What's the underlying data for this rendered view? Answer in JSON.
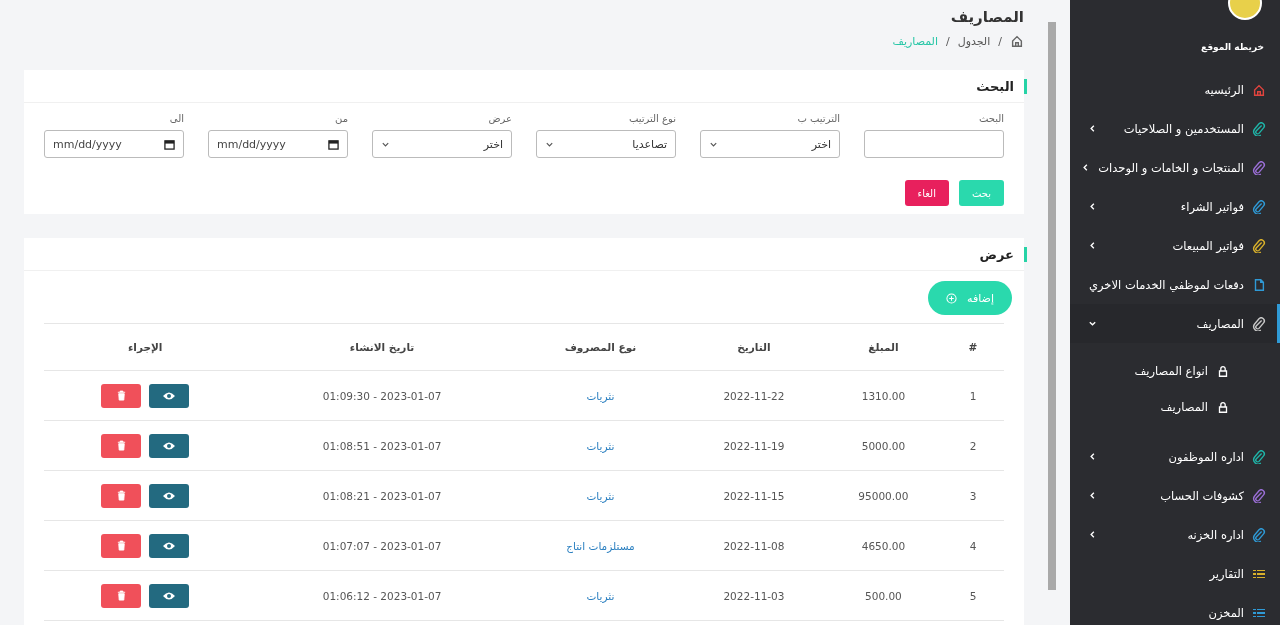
{
  "page": {
    "title": "المصاريف",
    "separator": "/",
    "breadcrumb": [
      {
        "label": "الجدول",
        "current": false
      },
      {
        "label": "المصاريف",
        "current": true
      }
    ]
  },
  "search": {
    "title": "البحث",
    "fields": [
      {
        "kind": "text",
        "label": "البحث"
      },
      {
        "kind": "select",
        "label": "الترتيب ب",
        "value": "اختر"
      },
      {
        "kind": "select",
        "label": "نوع الترتيب",
        "value": "تصاعديا"
      },
      {
        "kind": "select",
        "label": "عرض",
        "value": "اختر"
      },
      {
        "kind": "date",
        "label": "من",
        "placeholder": "mm/dd/yyyy"
      },
      {
        "kind": "date",
        "label": "الى",
        "placeholder": "mm/dd/yyyy"
      }
    ],
    "buttons": [
      {
        "label": "بحث",
        "kind": "primary"
      },
      {
        "label": "الغاء",
        "kind": "danger"
      }
    ]
  },
  "listing": {
    "title": "عرض",
    "add_button": "إضافه",
    "columns": [
      "#",
      "المبلغ",
      "التاريخ",
      "نوع المصروف",
      "تاريخ الانشاء",
      "الإجراء"
    ],
    "rows": [
      {
        "number": "1",
        "amount": "1310.00",
        "date": "2022-11-22",
        "type": "نثريات",
        "created": "01:09:30 - 2023-01-07"
      },
      {
        "number": "2",
        "amount": "5000.00",
        "date": "2022-11-19",
        "type": "نثريات",
        "created": "01:08:51 - 2023-01-07"
      },
      {
        "number": "3",
        "amount": "95000.00",
        "date": "2022-11-15",
        "type": "نثريات",
        "created": "01:08:21 - 2023-01-07"
      },
      {
        "number": "4",
        "amount": "4650.00",
        "date": "2022-11-08",
        "type": "مستلزمات انتاج",
        "created": "01:07:07 - 2023-01-07"
      },
      {
        "number": "5",
        "amount": "500.00",
        "date": "2022-11-03",
        "type": "نثريات",
        "created": "01:06:12 - 2023-01-07"
      }
    ]
  },
  "sidebar": {
    "heading": "خريطه الموقع",
    "items": [
      {
        "label": "الرئيسيه",
        "kind": "home",
        "color": "#e0443e",
        "selected": false
      },
      {
        "label": "المستخدمين و الصلاحيات",
        "kind": "clip",
        "color": "#1fb5a8",
        "expanded": false,
        "selected": false
      },
      {
        "label": "المنتجات و الخامات و الوحدات",
        "kind": "clip",
        "color": "#9b6fd6",
        "expanded": false,
        "selected": false
      },
      {
        "label": "فواتير الشراء",
        "kind": "clip",
        "color": "#2f9ad6",
        "expanded": false,
        "selected": false
      },
      {
        "label": "فواتير المبيعات",
        "kind": "clip",
        "color": "#d9b12b",
        "expanded": false,
        "selected": false
      },
      {
        "label": "دفعات لموظفي الخدمات الاخري",
        "kind": "page",
        "color": "#2f9ad6",
        "selected": false
      },
      {
        "label": "المصاريف",
        "kind": "clip",
        "color": "#c8c8c8",
        "expanded": true,
        "selected": true,
        "children": [
          {
            "label": "انواع المصاريف"
          },
          {
            "label": "المصاريف"
          }
        ]
      },
      {
        "label": "اداره الموظفون",
        "kind": "clip",
        "color": "#1fb5a8",
        "expanded": false,
        "selected": false
      },
      {
        "label": "كشوفات الحساب",
        "kind": "clip",
        "color": "#9b6fd6",
        "expanded": false,
        "selected": false
      },
      {
        "label": "اداره الخزنه",
        "kind": "clip",
        "color": "#2f9ad6",
        "expanded": false,
        "selected": false
      },
      {
        "label": "التقارير",
        "kind": "list",
        "color": "#d9b12b",
        "selected": false
      },
      {
        "label": "المخزن",
        "kind": "list",
        "color": "#2f9ad6",
        "selected": false
      }
    ]
  }
}
